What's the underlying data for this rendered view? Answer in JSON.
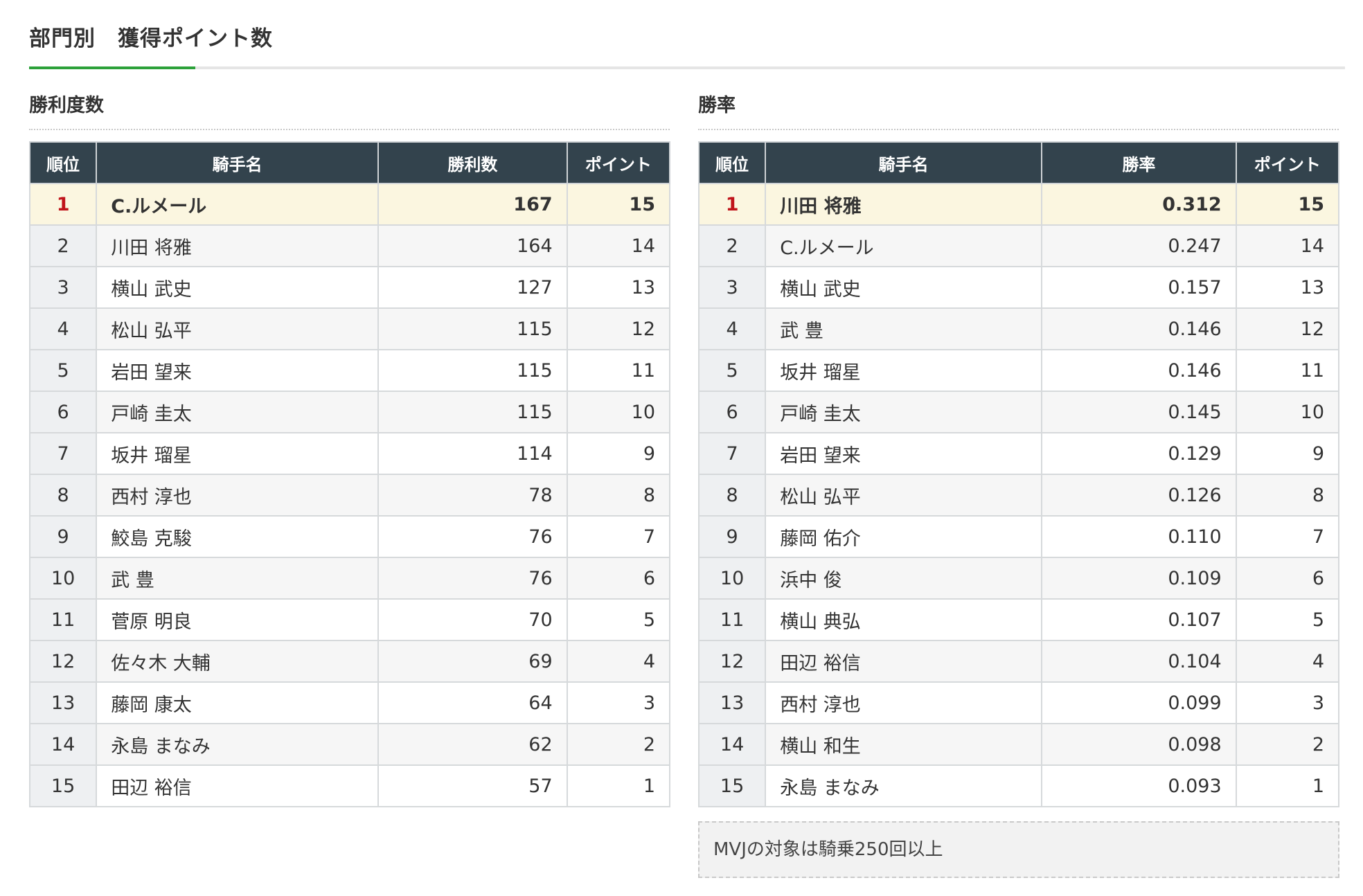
{
  "section": {
    "title": "部門別　獲得ポイント数"
  },
  "wins_table": {
    "title": "勝利度数",
    "headers": {
      "rank": "順位",
      "name": "騎手名",
      "value": "勝利数",
      "points": "ポイント"
    },
    "rows": [
      {
        "rank": "1",
        "name": "C.ルメール",
        "value": "167",
        "points": "15"
      },
      {
        "rank": "2",
        "name": "川田 将雅",
        "value": "164",
        "points": "14"
      },
      {
        "rank": "3",
        "name": "横山 武史",
        "value": "127",
        "points": "13"
      },
      {
        "rank": "4",
        "name": "松山 弘平",
        "value": "115",
        "points": "12"
      },
      {
        "rank": "5",
        "name": "岩田 望来",
        "value": "115",
        "points": "11"
      },
      {
        "rank": "6",
        "name": "戸崎 圭太",
        "value": "115",
        "points": "10"
      },
      {
        "rank": "7",
        "name": "坂井 瑠星",
        "value": "114",
        "points": "9"
      },
      {
        "rank": "8",
        "name": "西村 淳也",
        "value": "78",
        "points": "8"
      },
      {
        "rank": "9",
        "name": "鮫島 克駿",
        "value": "76",
        "points": "7"
      },
      {
        "rank": "10",
        "name": "武 豊",
        "value": "76",
        "points": "6"
      },
      {
        "rank": "11",
        "name": "菅原 明良",
        "value": "70",
        "points": "5"
      },
      {
        "rank": "12",
        "name": "佐々木 大輔",
        "value": "69",
        "points": "4"
      },
      {
        "rank": "13",
        "name": "藤岡 康太",
        "value": "64",
        "points": "3"
      },
      {
        "rank": "14",
        "name": "永島 まなみ",
        "value": "62",
        "points": "2"
      },
      {
        "rank": "15",
        "name": "田辺 裕信",
        "value": "57",
        "points": "1"
      }
    ]
  },
  "rate_table": {
    "title": "勝率",
    "headers": {
      "rank": "順位",
      "name": "騎手名",
      "value": "勝率",
      "points": "ポイント"
    },
    "rows": [
      {
        "rank": "1",
        "name": "川田 将雅",
        "value": "0.312",
        "points": "15"
      },
      {
        "rank": "2",
        "name": "C.ルメール",
        "value": "0.247",
        "points": "14"
      },
      {
        "rank": "3",
        "name": "横山 武史",
        "value": "0.157",
        "points": "13"
      },
      {
        "rank": "4",
        "name": "武 豊",
        "value": "0.146",
        "points": "12"
      },
      {
        "rank": "5",
        "name": "坂井 瑠星",
        "value": "0.146",
        "points": "11"
      },
      {
        "rank": "6",
        "name": "戸崎 圭太",
        "value": "0.145",
        "points": "10"
      },
      {
        "rank": "7",
        "name": "岩田 望来",
        "value": "0.129",
        "points": "9"
      },
      {
        "rank": "8",
        "name": "松山 弘平",
        "value": "0.126",
        "points": "8"
      },
      {
        "rank": "9",
        "name": "藤岡 佑介",
        "value": "0.110",
        "points": "7"
      },
      {
        "rank": "10",
        "name": "浜中 俊",
        "value": "0.109",
        "points": "6"
      },
      {
        "rank": "11",
        "name": "横山 典弘",
        "value": "0.107",
        "points": "5"
      },
      {
        "rank": "12",
        "name": "田辺 裕信",
        "value": "0.104",
        "points": "4"
      },
      {
        "rank": "13",
        "name": "西村 淳也",
        "value": "0.099",
        "points": "3"
      },
      {
        "rank": "14",
        "name": "横山 和生",
        "value": "0.098",
        "points": "2"
      },
      {
        "rank": "15",
        "name": "永島 まなみ",
        "value": "0.093",
        "points": "1"
      }
    ],
    "note": "MVJの対象は騎乗250回以上"
  },
  "colors": {
    "header_bg": "#33434d",
    "accent_green": "#2ca13a",
    "top_row_bg": "#fbf6e0",
    "top_rank_red": "#c0141b"
  }
}
